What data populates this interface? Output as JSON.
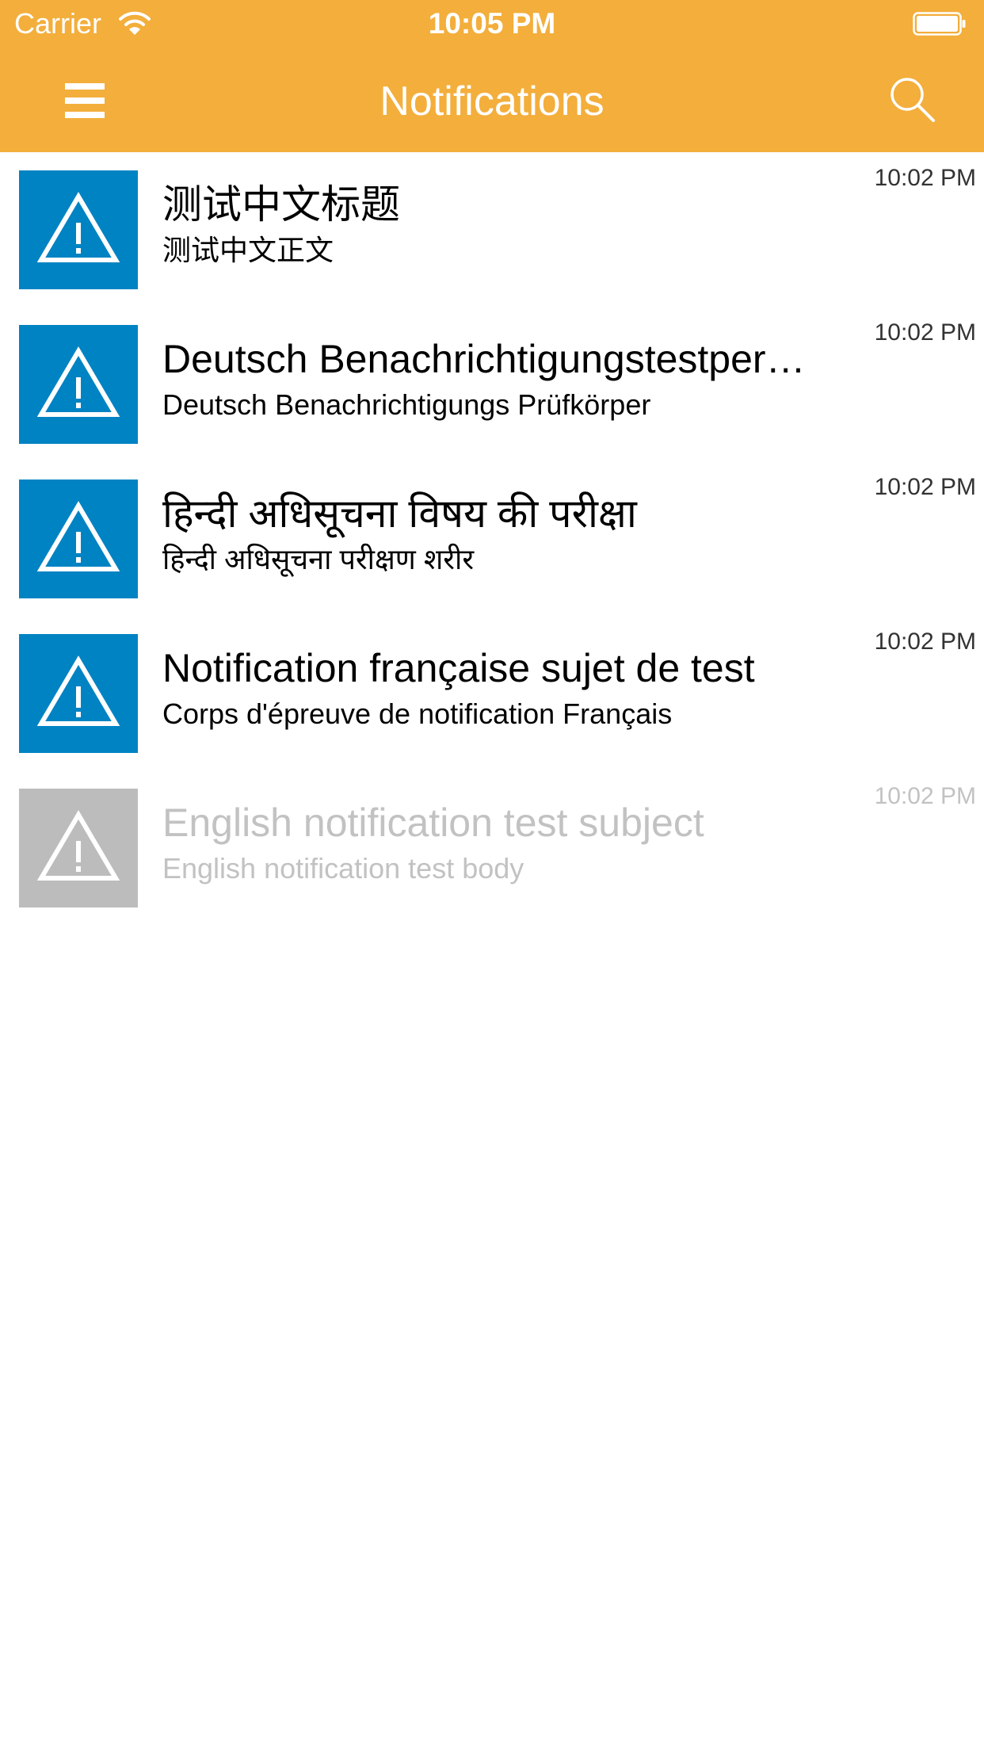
{
  "status_bar": {
    "carrier": "Carrier",
    "time": "10:05 PM"
  },
  "nav": {
    "title": "Notifications",
    "menu_icon": "hamburger-menu-icon",
    "search_icon": "search-icon"
  },
  "colors": {
    "header": "#f3ae3b",
    "unread_thumb": "#0083c3",
    "read_thumb": "#bcbcbc",
    "read_text": "#c2c2c2"
  },
  "notifications": [
    {
      "subject": "测试中文标题",
      "body": "测试中文正文",
      "time": "10:02 PM",
      "icon": "warning-icon",
      "read": false
    },
    {
      "subject": "Deutsch Benachrichtigungstestpersonenbetreff",
      "body": "Deutsch Benachrichtigungs Prüfkörper",
      "time": "10:02 PM",
      "icon": "warning-icon",
      "read": false
    },
    {
      "subject": "हिन्दी अधिसूचना विषय की परीक्षा",
      "body": "हिन्दी अधिसूचना परीक्षण शरीर",
      "time": "10:02 PM",
      "icon": "warning-icon",
      "read": false
    },
    {
      "subject": "Notification française sujet de test",
      "body": "Corps d'épreuve de notification Français",
      "time": "10:02 PM",
      "icon": "warning-icon",
      "read": false
    },
    {
      "subject": "English notification test subject",
      "body": "English notification test body",
      "time": "10:02 PM",
      "icon": "warning-icon",
      "read": true
    }
  ]
}
